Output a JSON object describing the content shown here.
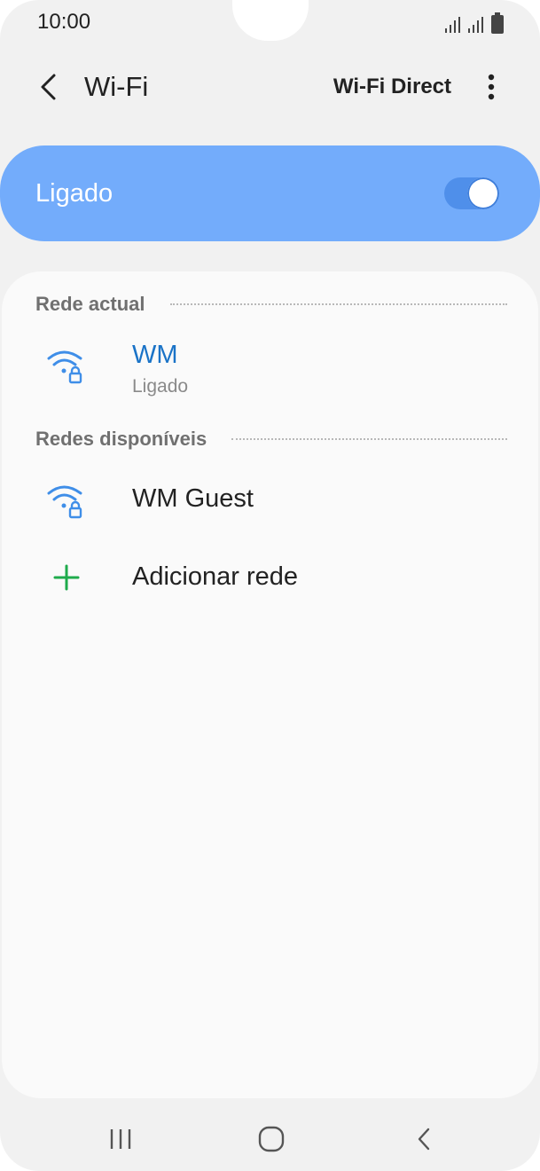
{
  "status_bar": {
    "time": "10:00",
    "icons": [
      "signal-icon",
      "signal-icon",
      "battery-icon"
    ]
  },
  "app_bar": {
    "title": "Wi-Fi",
    "wifi_direct_label": "Wi-Fi Direct"
  },
  "master_toggle": {
    "label": "Ligado",
    "on": true
  },
  "current_section": {
    "title": "Rede actual",
    "network": {
      "name": "WM",
      "status": "Ligado"
    }
  },
  "available_section": {
    "title": "Redes disponíveis",
    "networks": [
      {
        "name": "WM Guest"
      }
    ]
  },
  "add_network": {
    "label": "Adicionar rede"
  },
  "colors": {
    "accent": "#73acfb",
    "connected": "#1a73c7",
    "add": "#1fab4c"
  }
}
